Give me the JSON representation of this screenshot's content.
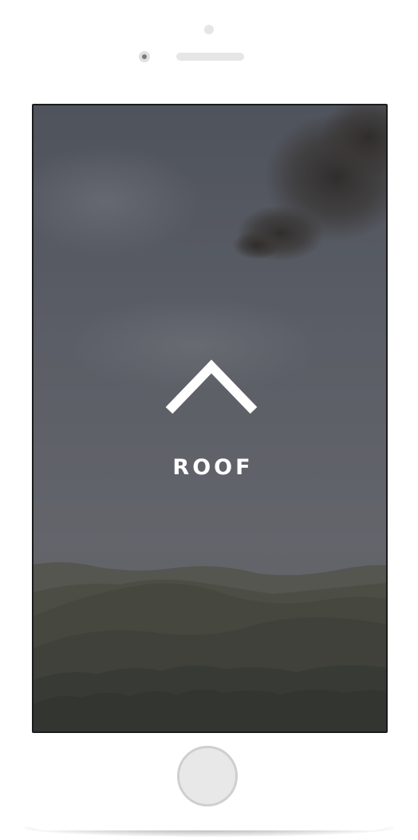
{
  "screen": {
    "label": "ROOF",
    "icon": "roof-chevron-icon"
  },
  "device": {
    "home_button_icon": "home-button",
    "camera_icon": "front-camera-icon",
    "speaker_icon": "earpiece-speaker-icon",
    "sensor_icon": "proximity-sensor-icon"
  },
  "colors": {
    "overlay": "#5b5e66",
    "foreground": "#ffffff",
    "device_body": "#ffffff",
    "screen_border": "#1c1c1e"
  }
}
